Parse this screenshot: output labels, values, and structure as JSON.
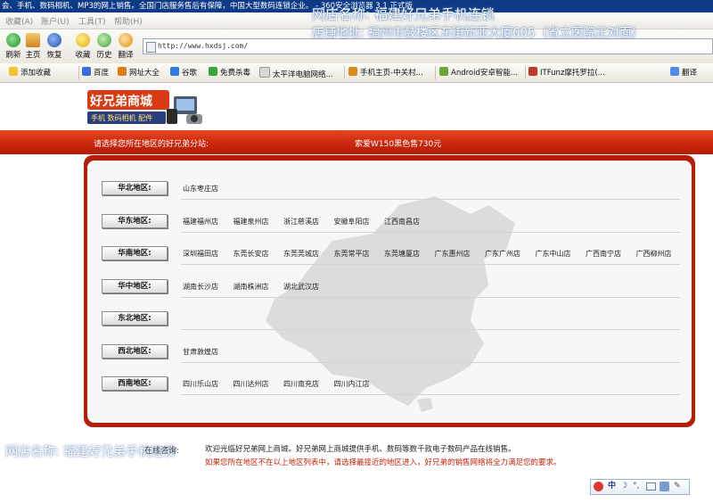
{
  "browser": {
    "title_bar": "会、手机、数码相机、MP3的网上销售。全国门店服务售后有保障，中国大型数码连锁企业。 - 360安全浏览器 3.1 正式版",
    "menu": [
      "收藏(A)",
      "账户(U)",
      "工具(T)",
      "帮助(H)"
    ],
    "toolbar": [
      "刷新",
      "主页",
      "恢复",
      "收藏",
      "历史",
      "翻译"
    ],
    "address": "http://www.hxdsj.com/",
    "favorites_bar": [
      "添加收藏",
      "百度",
      "网址大全",
      "谷歌",
      "免费杀毒",
      "太平洋电脑网络...",
      "手机主页-中关村...",
      "Android安卓智能...",
      "ITFunz摩托罗拉(..."
    ],
    "translate_label": "翻译",
    "tray_icons": [
      "sogou-s-icon",
      "zh-icon",
      "moon-icon",
      "punct-icon",
      "keyboard-icon",
      "shirt-icon",
      "wrench-icon"
    ]
  },
  "watermark": {
    "store_name": "网店名称: 福建好兄弟手机连锁",
    "store_address": "店铺地址: 福州市鼓楼区东街新亚大厦605（省立医院正对面）",
    "bottom_left": "网店名称: 福建好兄弟手机连锁"
  },
  "site": {
    "logo_title": "好兄弟商城",
    "logo_subtitle": "手机 数码相机 配件",
    "select_prompt": "请选择您所在地区的好兄弟分站:",
    "promo": "索爱W150黑色售730元",
    "regions": [
      {
        "label": "华北地区:",
        "stores": [
          "山东枣庄店"
        ]
      },
      {
        "label": "华东地区:",
        "stores": [
          "福建福州店",
          "福建泉州店",
          "浙江慈溪店",
          "安徽阜阳店",
          "江西南昌店"
        ]
      },
      {
        "label": "华南地区:",
        "stores": [
          "深圳福田店",
          "东莞长安店",
          "东莞莞城店",
          "东莞常平店",
          "东莞塘厦店",
          "广东惠州店",
          "广东广州店",
          "广东中山店",
          "广西南宁店",
          "广西柳州店"
        ]
      },
      {
        "label": "华中地区:",
        "stores": [
          "湖南长沙店",
          "湖南株洲店",
          "湖北武汉店"
        ]
      },
      {
        "label": "东北地区:",
        "stores": []
      },
      {
        "label": "西北地区:",
        "stores": [
          "甘肃敦煌店"
        ]
      },
      {
        "label": "西南地区:",
        "stores": [
          "四川乐山店",
          "四川达州店",
          "四川南充店",
          "四川内江店"
        ]
      }
    ],
    "welcome_label": "在线咨询:",
    "footer_line1": "欢迎光临好兄弟网上商城。好兄弟网上商城提供手机、数码等数千款电子数码产品在线销售。",
    "footer_line2": "如果您所在地区不在以上地区列表中，请选择最接近的地区进入，好兄弟的销售网络将全力满足您的要求。"
  },
  "colors": {
    "brand_red": "#c9270c",
    "title_blue": "#0c3a86"
  }
}
